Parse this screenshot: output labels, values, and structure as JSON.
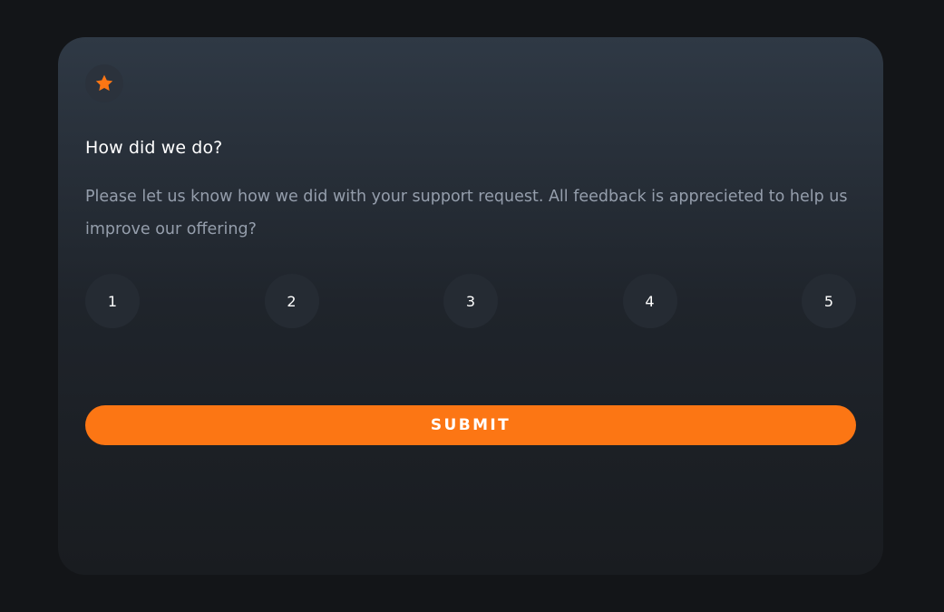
{
  "card": {
    "icon": "star-icon",
    "accent_color": "#fc7614",
    "title": "How did we do?",
    "description": "Please let us know how we did with your support request. All feedback is apprecieted to help us improve our offering?"
  },
  "ratings": [
    "1",
    "2",
    "3",
    "4",
    "5"
  ],
  "submit_label": "SUBMIT"
}
